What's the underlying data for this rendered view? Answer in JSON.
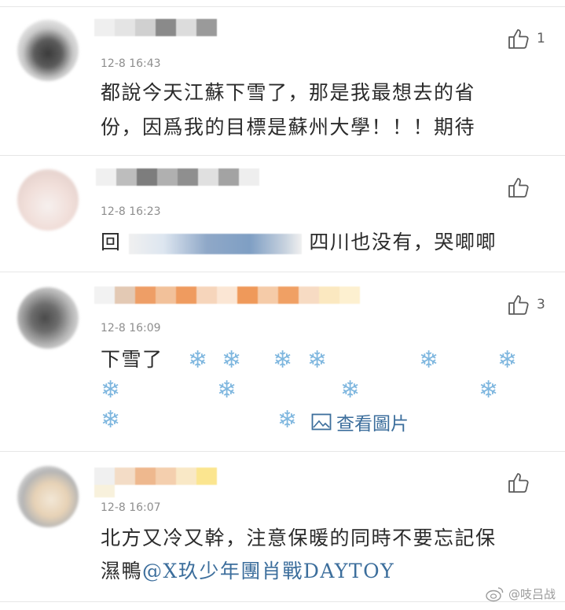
{
  "comments": [
    {
      "time": "12-8 16:43",
      "text_line1": "都說今天江蘇下雪了，那是我最想去的省",
      "text_line2": "份，因爲我的目標是蘇州大學！！！期待",
      "likes": "1"
    },
    {
      "time": "12-8 16:23",
      "text_prefix": "回",
      "text_suffix": "四川也没有，哭唧唧",
      "likes": ""
    },
    {
      "time": "12-8 16:09",
      "text": "下雪了",
      "snow": "❄",
      "view_picture": "查看圖片",
      "likes": "3"
    },
    {
      "time": "12-8 16:07",
      "text_line1": "北方又冷又幹，注意保暖的同時不要忘記保",
      "text_line2_plain": "濕鴨",
      "mention": "@X玖少年團肖戰DAYTOY",
      "likes": ""
    }
  ],
  "watermark": "@吱吕战",
  "colors": {
    "link": "#3c6e9c",
    "time": "#8e8e8e",
    "snow": "#7fb7df",
    "divider": "#e6e6e6"
  },
  "icons": [
    "thumbs-up-icon",
    "image-icon",
    "snowflake-icon",
    "weibo-icon"
  ]
}
